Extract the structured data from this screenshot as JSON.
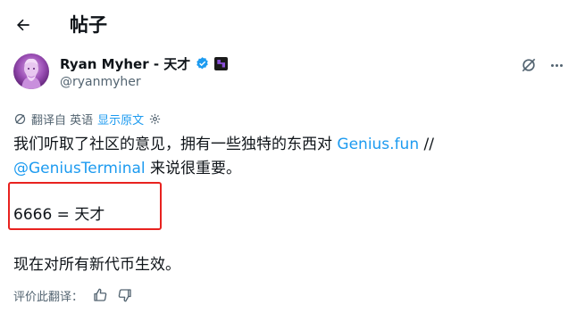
{
  "header": {
    "title": "帖子"
  },
  "author": {
    "display_name": "Ryan Myher - 天才",
    "handle": "@ryanmyher"
  },
  "translation": {
    "label": "翻译自 英语",
    "show_original": "显示原文"
  },
  "tweet": {
    "line1_prefix": "我们听取了社区的意见，拥有一些独特的东西对 ",
    "line1_link": "Genius.fun",
    "line1_suffix": " //",
    "line2_mention": "@GeniusTerminal",
    "line2_suffix": " 来说很重要。",
    "line3": "6666 = 天才",
    "line4": "现在对所有新代币生效。"
  },
  "rating": {
    "label": "评价此翻译："
  },
  "colors": {
    "accent": "#1d9bf0",
    "highlight": "#e8221f",
    "secondary_text": "#536471"
  }
}
